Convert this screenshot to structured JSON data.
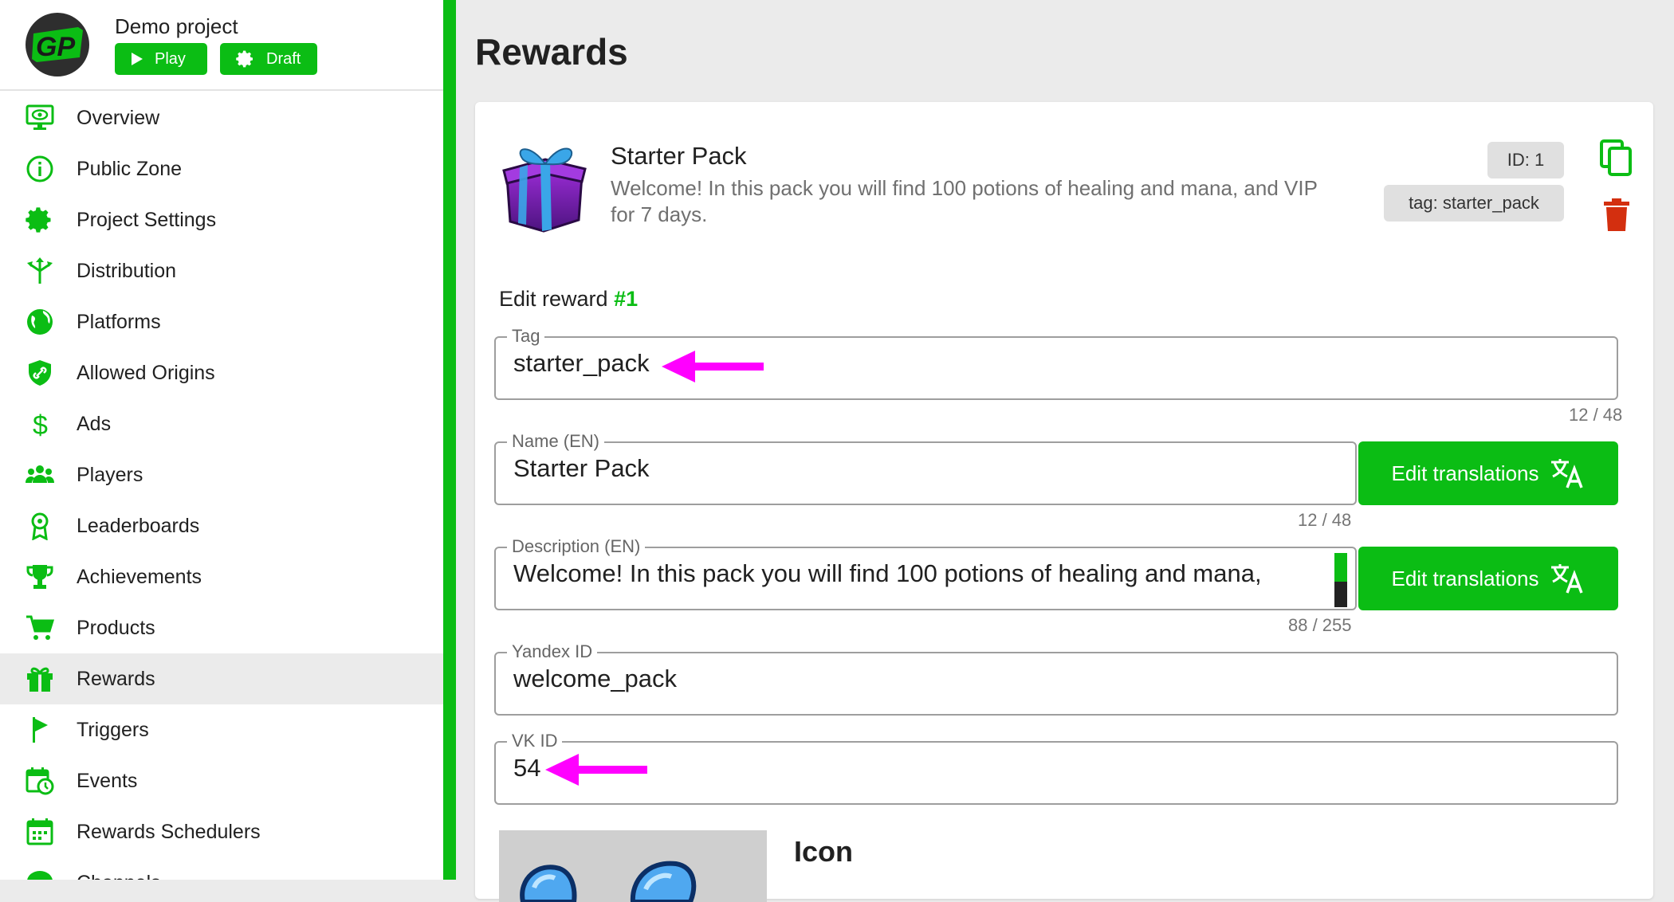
{
  "project": {
    "name": "Demo project",
    "play_label": "Play",
    "draft_label": "Draft"
  },
  "sidebar": {
    "items": [
      {
        "label": "Overview",
        "icon": "monitor-eye-icon"
      },
      {
        "label": "Public Zone",
        "icon": "info-circle-icon"
      },
      {
        "label": "Project Settings",
        "icon": "gear-icon"
      },
      {
        "label": "Distribution",
        "icon": "distribution-arrows-icon"
      },
      {
        "label": "Platforms",
        "icon": "globe-icon"
      },
      {
        "label": "Allowed Origins",
        "icon": "shield-link-icon"
      },
      {
        "label": "Ads",
        "icon": "dollar-icon"
      },
      {
        "label": "Players",
        "icon": "people-icon"
      },
      {
        "label": "Leaderboards",
        "icon": "award-ribbon-icon"
      },
      {
        "label": "Achievements",
        "icon": "trophy-icon"
      },
      {
        "label": "Products",
        "icon": "cart-icon"
      },
      {
        "label": "Rewards",
        "icon": "gift-icon",
        "active": true
      },
      {
        "label": "Triggers",
        "icon": "flag-icon"
      },
      {
        "label": "Events",
        "icon": "calendar-clock-icon"
      },
      {
        "label": "Rewards Schedulers",
        "icon": "calendar-grid-icon"
      },
      {
        "label": "Channels",
        "icon": "chat-icon"
      }
    ]
  },
  "page": {
    "title": "Rewards"
  },
  "reward": {
    "title": "Starter Pack",
    "description": "Welcome! In this pack you will find 100 potions of healing and mana, and VIP for 7 days.",
    "id_chip": "ID: 1",
    "tag_chip": "tag: starter_pack"
  },
  "edit": {
    "heading": "Edit reward",
    "number": "#1",
    "tag": {
      "label": "Tag",
      "value": "starter_pack",
      "counter": "12 / 48"
    },
    "name": {
      "label": "Name (EN)",
      "value": "Starter Pack",
      "counter": "12 / 48"
    },
    "description": {
      "label": "Description (EN)",
      "value": "Welcome! In this pack you will find 100 potions of healing and mana,",
      "counter": "88 / 255"
    },
    "yandex": {
      "label": "Yandex ID",
      "value": "welcome_pack"
    },
    "vk": {
      "label": "VK ID",
      "value": "54"
    },
    "translate_label": "Edit translations",
    "icon_heading": "Icon"
  },
  "colors": {
    "accent": "#0bbd14",
    "arrow": "#ff00ff",
    "danger": "#d32f0f"
  }
}
